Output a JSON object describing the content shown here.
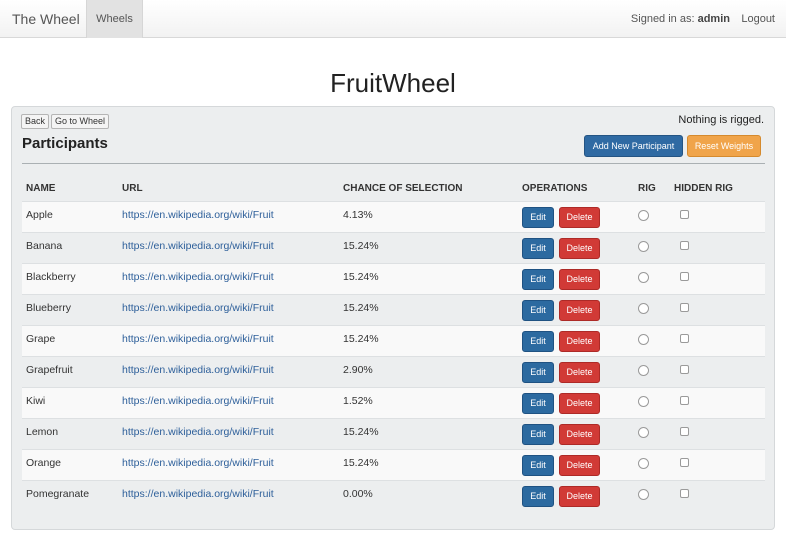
{
  "navbar": {
    "brand": "The Wheel",
    "active_tab": "Wheels",
    "signed_in_label": "Signed in as:",
    "username": "admin",
    "logout": "Logout"
  },
  "page": {
    "title": "FruitWheel"
  },
  "panel": {
    "back_button": "Back",
    "go_to_wheel_button": "Go to Wheel",
    "rig_status": "Nothing is rigged.",
    "section_title": "Participants",
    "add_button": "Add New Participant",
    "reset_button": "Reset Weights",
    "colors": {
      "primary": "#2f6aa3",
      "warning": "#f0a44a",
      "danger": "#d13a36",
      "link": "#2d5f9a"
    }
  },
  "table": {
    "headers": [
      "NAME",
      "URL",
      "CHANCE OF SELECTION",
      "OPERATIONS",
      "RIG",
      "HIDDEN RIG"
    ],
    "edit_label": "Edit",
    "delete_label": "Delete",
    "rows": [
      {
        "name": "Apple",
        "url": "https://en.wikipedia.org/wiki/Fruit",
        "chance": "4.13%",
        "rig": false,
        "hidden_rig": false
      },
      {
        "name": "Banana",
        "url": "https://en.wikipedia.org/wiki/Fruit",
        "chance": "15.24%",
        "rig": false,
        "hidden_rig": false
      },
      {
        "name": "Blackberry",
        "url": "https://en.wikipedia.org/wiki/Fruit",
        "chance": "15.24%",
        "rig": false,
        "hidden_rig": false
      },
      {
        "name": "Blueberry",
        "url": "https://en.wikipedia.org/wiki/Fruit",
        "chance": "15.24%",
        "rig": false,
        "hidden_rig": false
      },
      {
        "name": "Grape",
        "url": "https://en.wikipedia.org/wiki/Fruit",
        "chance": "15.24%",
        "rig": false,
        "hidden_rig": false
      },
      {
        "name": "Grapefruit",
        "url": "https://en.wikipedia.org/wiki/Fruit",
        "chance": "2.90%",
        "rig": false,
        "hidden_rig": false
      },
      {
        "name": "Kiwi",
        "url": "https://en.wikipedia.org/wiki/Fruit",
        "chance": "1.52%",
        "rig": false,
        "hidden_rig": false
      },
      {
        "name": "Lemon",
        "url": "https://en.wikipedia.org/wiki/Fruit",
        "chance": "15.24%",
        "rig": false,
        "hidden_rig": false
      },
      {
        "name": "Orange",
        "url": "https://en.wikipedia.org/wiki/Fruit",
        "chance": "15.24%",
        "rig": false,
        "hidden_rig": false
      },
      {
        "name": "Pomegranate",
        "url": "https://en.wikipedia.org/wiki/Fruit",
        "chance": "0.00%",
        "rig": false,
        "hidden_rig": false
      }
    ]
  }
}
